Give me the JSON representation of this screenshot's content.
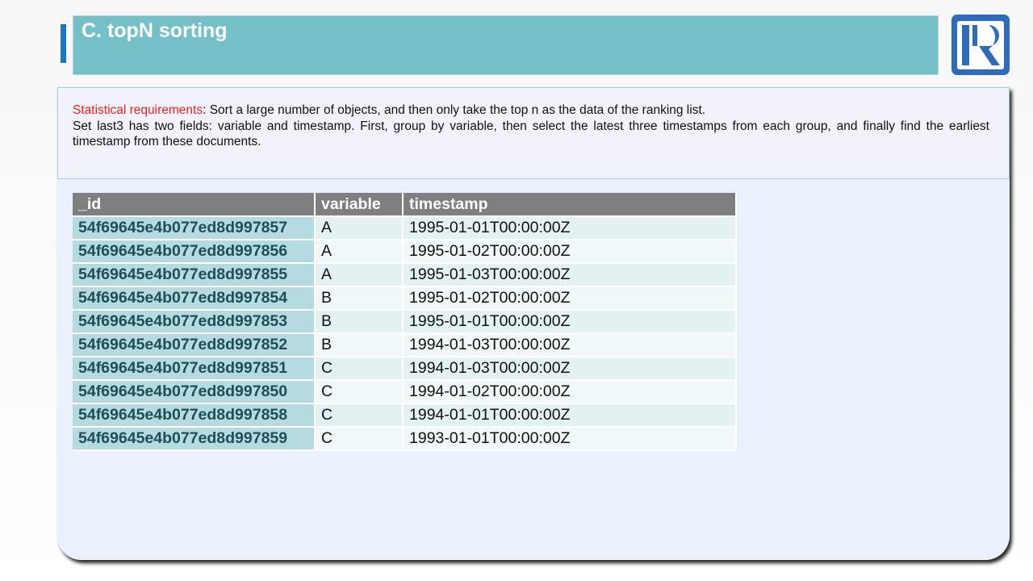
{
  "header": {
    "title": "C. topN sorting"
  },
  "description": {
    "req_label": "Statistical requirements",
    "req_text": ": Sort a large number of objects, and then only take the top n as the data of the ranking list.",
    "detail_text": "Set last3 has two fields: variable and timestamp. First, group by variable, then select the latest three timestamps from each group, and finally find the earliest timestamp from these documents."
  },
  "table": {
    "headers": [
      "_id",
      "variable",
      "timestamp"
    ],
    "rows": [
      {
        "id": "54f69645e4b077ed8d997857",
        "variable": "A",
        "timestamp": "1995-01-01T00:00:00Z"
      },
      {
        "id": "54f69645e4b077ed8d997856",
        "variable": "A",
        "timestamp": "1995-01-02T00:00:00Z"
      },
      {
        "id": "54f69645e4b077ed8d997855",
        "variable": "A",
        "timestamp": "1995-01-03T00:00:00Z"
      },
      {
        "id": "54f69645e4b077ed8d997854",
        "variable": "B",
        "timestamp": "1995-01-02T00:00:00Z"
      },
      {
        "id": "54f69645e4b077ed8d997853",
        "variable": "B",
        "timestamp": "1995-01-01T00:00:00Z"
      },
      {
        "id": "54f69645e4b077ed8d997852",
        "variable": "B",
        "timestamp": "1994-01-03T00:00:00Z"
      },
      {
        "id": "54f69645e4b077ed8d997851",
        "variable": "C",
        "timestamp": "1994-01-03T00:00:00Z"
      },
      {
        "id": "54f69645e4b077ed8d997850",
        "variable": "C",
        "timestamp": "1994-01-02T00:00:00Z"
      },
      {
        "id": "54f69645e4b077ed8d997858",
        "variable": "C",
        "timestamp": "1994-01-01T00:00:00Z"
      },
      {
        "id": "54f69645e4b077ed8d997859",
        "variable": "C",
        "timestamp": "1993-01-01T00:00:00Z"
      }
    ]
  },
  "colors": {
    "title_bar": "#73c0c7",
    "accent": "#1777c9",
    "logo": "#2f6bbb",
    "requirement_label": "#ff1a1a",
    "header_row": "#7f7f7f",
    "id_column": "#b5dadf"
  },
  "icons": {
    "logo": "r-logo-icon"
  }
}
